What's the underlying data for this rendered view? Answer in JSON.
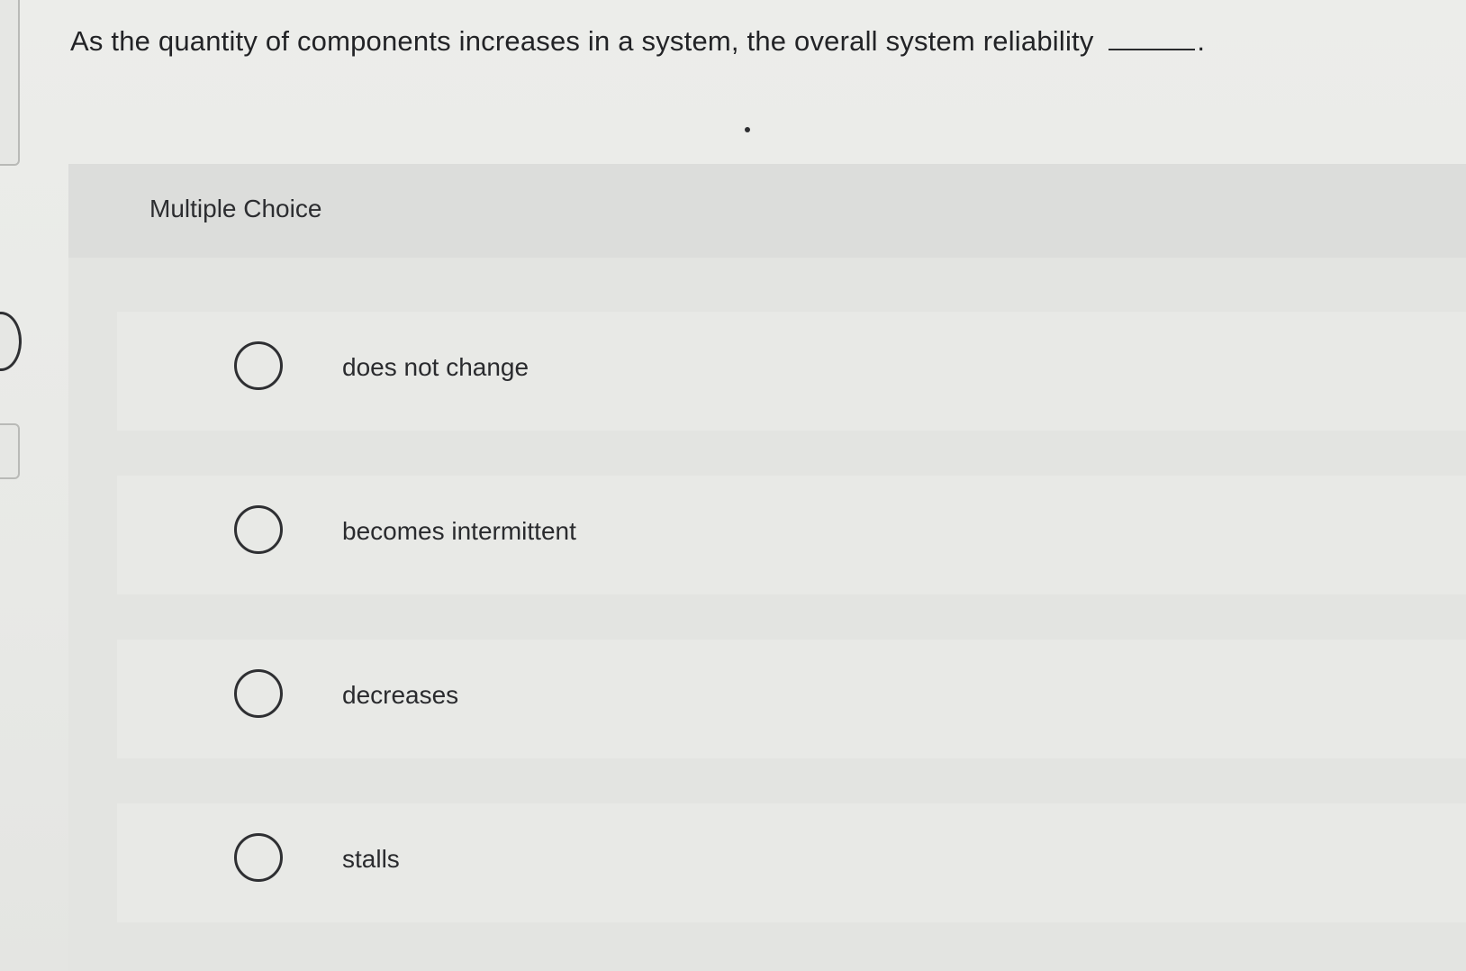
{
  "question": {
    "text": "As the quantity of components increases in a system, the overall system reliability",
    "blank_suffix": "."
  },
  "section": {
    "label": "Multiple Choice"
  },
  "options": [
    {
      "label": "does not change",
      "selected": false
    },
    {
      "label": "becomes intermittent",
      "selected": false
    },
    {
      "label": "decreases",
      "selected": false
    },
    {
      "label": "stalls",
      "selected": false
    }
  ]
}
